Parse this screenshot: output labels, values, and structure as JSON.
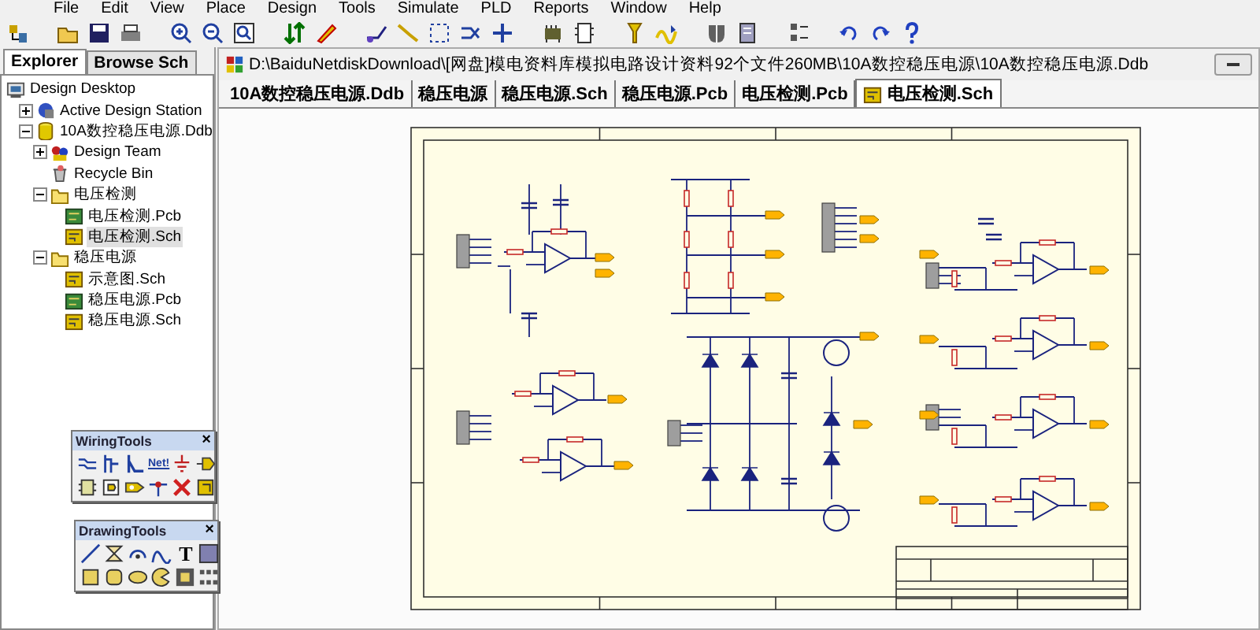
{
  "menu": [
    "File",
    "Edit",
    "View",
    "Place",
    "Design",
    "Tools",
    "Simulate",
    "PLD",
    "Reports",
    "Window",
    "Help"
  ],
  "panel": {
    "tabs": [
      {
        "label": "Explorer",
        "selected": true
      },
      {
        "label": "Browse Sch",
        "selected": false
      }
    ],
    "tree": [
      {
        "label": "Design Desktop",
        "kind": "desktop",
        "selected": false,
        "children": [
          {
            "label": "Active Design Station",
            "kind": "station",
            "expanded": false,
            "selected": false
          },
          {
            "label": "10A数控稳压电源.Ddb",
            "kind": "database",
            "expanded": true,
            "selected": false,
            "children": [
              {
                "label": "Design Team",
                "kind": "team",
                "expanded": false,
                "selected": false
              },
              {
                "label": "Recycle Bin",
                "kind": "recycle",
                "selected": false
              },
              {
                "label": "电压检测",
                "kind": "folder",
                "expanded": true,
                "selected": false,
                "children": [
                  {
                    "label": "电压检测.Pcb",
                    "kind": "pcb",
                    "selected": false
                  },
                  {
                    "label": "电压检测.Sch",
                    "kind": "sch",
                    "selected": true
                  }
                ]
              },
              {
                "label": "稳压电源",
                "kind": "folder",
                "expanded": true,
                "selected": false,
                "children": [
                  {
                    "label": "示意图.Sch",
                    "kind": "sch",
                    "selected": false
                  },
                  {
                    "label": "稳压电源.Pcb",
                    "kind": "pcb",
                    "selected": false
                  },
                  {
                    "label": "稳压电源.Sch",
                    "kind": "sch",
                    "selected": false
                  }
                ]
              }
            ]
          }
        ]
      }
    ]
  },
  "document": {
    "title": "D:\\BaiduNetdiskDownload\\[网盘]模电资料库模拟电路设计资料92个文件260MB\\10A数控稳压电源\\10A数控稳压电源.Ddb",
    "tabs": [
      {
        "label": "10A数控稳压电源.Ddb",
        "selected": false
      },
      {
        "label": "稳压电源",
        "selected": false
      },
      {
        "label": "稳压电源.Sch",
        "selected": false
      },
      {
        "label": "稳压电源.Pcb",
        "selected": false
      },
      {
        "label": "电压检测.Pcb",
        "selected": false
      },
      {
        "label": "电压检测.Sch",
        "selected": true
      }
    ]
  },
  "wiring_tools": {
    "title": "WiringTools",
    "close": "×",
    "tools": [
      {
        "kind": "wire"
      },
      {
        "kind": "bus"
      },
      {
        "kind": "bus-entry"
      },
      {
        "kind": "net-label",
        "label": "Net!"
      },
      {
        "kind": "ground"
      },
      {
        "kind": "power-port"
      },
      {
        "kind": "sheet-symbol"
      },
      {
        "kind": "sheet-entry"
      },
      {
        "kind": "port"
      },
      {
        "kind": "junction"
      },
      {
        "kind": "no-erc"
      },
      {
        "kind": "part"
      }
    ]
  },
  "drawing_tools": {
    "title": "DrawingTools",
    "close": "×",
    "tools": [
      {
        "kind": "line"
      },
      {
        "kind": "polygon"
      },
      {
        "kind": "arc"
      },
      {
        "kind": "bezier"
      },
      {
        "kind": "text",
        "label": "T"
      },
      {
        "kind": "image"
      },
      {
        "kind": "rectangle"
      },
      {
        "kind": "round-rectangle"
      },
      {
        "kind": "ellipse"
      },
      {
        "kind": "pie"
      },
      {
        "kind": "frame"
      },
      {
        "kind": "array"
      }
    ]
  }
}
